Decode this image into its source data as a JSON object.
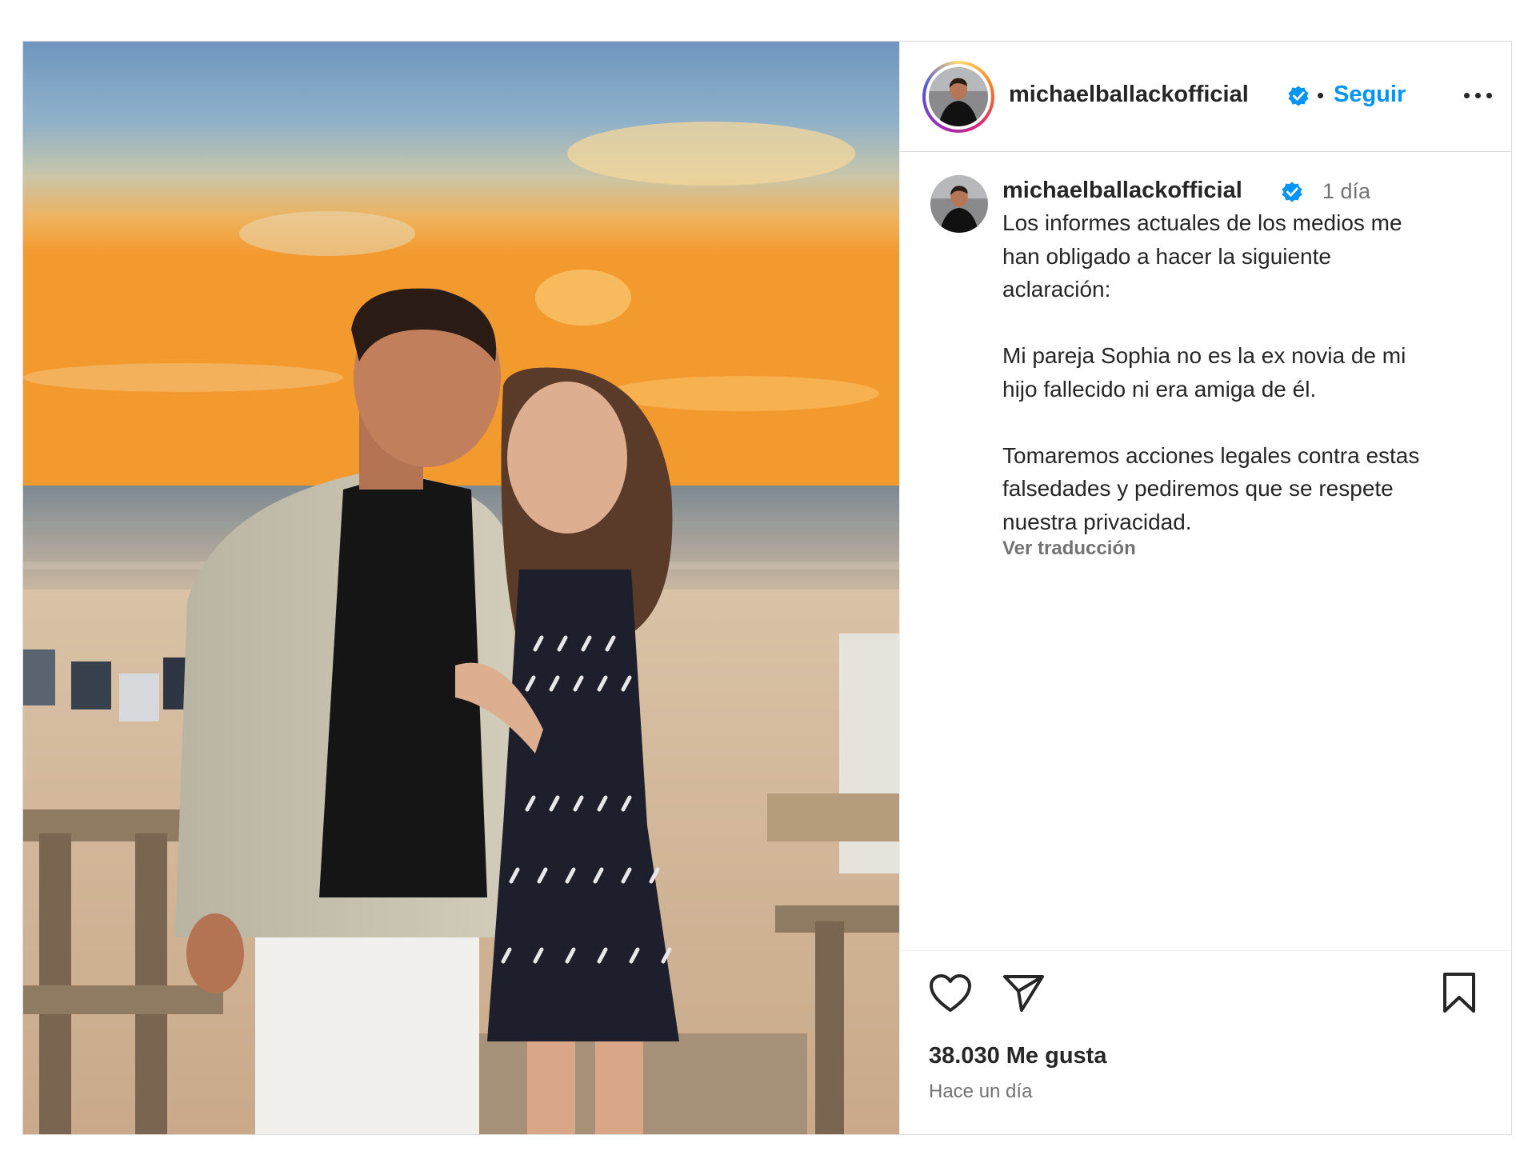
{
  "post": {
    "photo_alt": "",
    "header": {
      "username": "michaelballackofficial",
      "separator": "•",
      "follow_label": "Seguir",
      "more_icon": "more-options-icon"
    },
    "caption": {
      "username": "michaelballackofficial",
      "time": "1 día",
      "text": "Los informes actuales de los medios me\nhan obligado a hacer la siguiente\naclaración:\n\nMi pareja Sophia no es la ex novia de mi\nhijo fallecido ni era amiga de él.\n\nTomaremos acciones legales contra estas\nfalsedades y pediremos que se respete\nnuestra privacidad.",
      "translate_label": "Ver traducción"
    },
    "actions": {
      "like_icon": "heart-icon",
      "share_icon": "send-icon",
      "save_icon": "bookmark-icon"
    },
    "likes": "38.030 Me gusta",
    "posted": "Hace un día",
    "colors": {
      "link": "#0095f6",
      "verified": "#0095f6",
      "text": "#262626",
      "muted": "#737373",
      "border": "#dbdbdb"
    }
  }
}
